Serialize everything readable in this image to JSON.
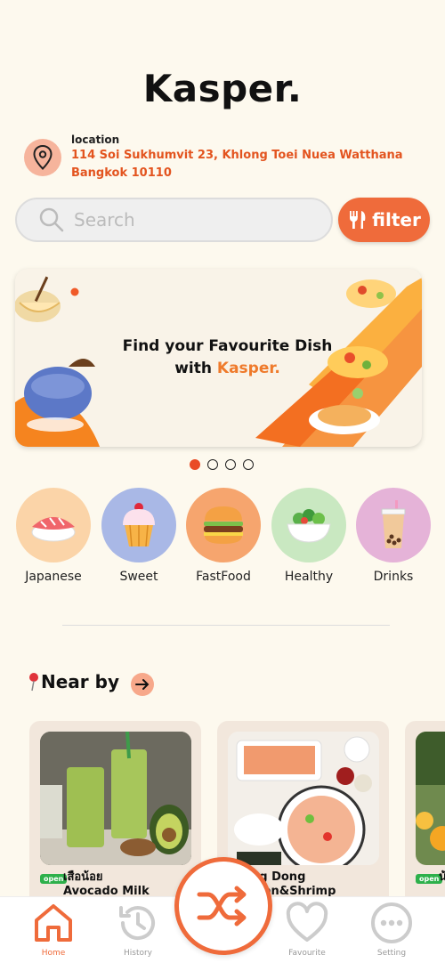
{
  "app": {
    "title": "Kasper."
  },
  "location": {
    "label": "location",
    "address_line1": "114 Soi Sukhumvit 23, Khlong Toei Nuea Watthana",
    "address_line2": "Bangkok 10110"
  },
  "search": {
    "placeholder": "Search",
    "filter_label": "filter"
  },
  "banner": {
    "line1": "Find your Favourite Dish",
    "line2_prefix": "with ",
    "line2_accent": "Kasper."
  },
  "carousel": {
    "count": 4,
    "active": 0
  },
  "categories": [
    {
      "label": "Japanese",
      "icon": "sushi-icon",
      "color": "#fbd4a8"
    },
    {
      "label": "Sweet",
      "icon": "cupcake-icon",
      "color": "#a9b8e6"
    },
    {
      "label": "FastFood",
      "icon": "burger-icon",
      "color": "#f6a56e"
    },
    {
      "label": "Healthy",
      "icon": "salad-icon",
      "color": "#c9e8c1"
    },
    {
      "label": "Drinks",
      "icon": "bubble-tea-icon",
      "color": "#e5b3d8"
    }
  ],
  "nearby": {
    "title": "Near by",
    "cards": [
      {
        "badge": "open",
        "name_line1": "เสือน้อย",
        "name_line2": "Avocado Milk"
      },
      {
        "badge": "",
        "name_line1": "ng Dong",
        "name_line2": "mon&Shrimp"
      },
      {
        "badge": "open",
        "name_line1": "น้",
        "name_line2": ""
      }
    ]
  },
  "bottom_nav": {
    "items": [
      {
        "label": "Home",
        "icon": "home-icon",
        "active": true
      },
      {
        "label": "History",
        "icon": "history-icon",
        "active": false
      },
      {
        "label": "Favourite",
        "icon": "heart-icon",
        "active": false
      },
      {
        "label": "Setting",
        "icon": "more-icon",
        "active": false
      }
    ],
    "center_icon": "shuffle-icon"
  },
  "colors": {
    "accent": "#ef6b3b",
    "address": "#e3541f",
    "background": "#fdf9ee"
  }
}
